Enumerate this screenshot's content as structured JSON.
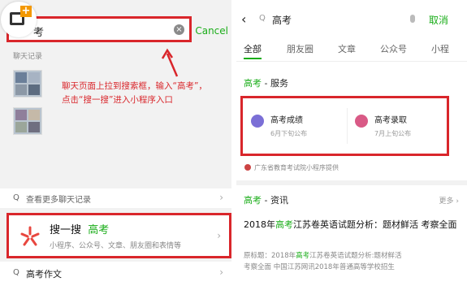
{
  "left": {
    "search_query": "考",
    "clear_glyph": "×",
    "cancel_label": "Cancel",
    "logo_plus": "+",
    "section_title": "聊天记录",
    "annotation_lines": [
      "聊天页面上拉到搜索框，输入“高考”，",
      "点击“搜一搜”进入小程序入口"
    ],
    "more_chat": "查看更多聊天记录",
    "search_item": {
      "title": "搜一搜",
      "keyword": "高考",
      "subtitle": "小程序、公众号、文章、朋友圈和表情等"
    },
    "bottom_item": "高考作文",
    "chevron": "›",
    "search_glyph": "Q",
    "accent_color": "#d9262b"
  },
  "right": {
    "back_glyph": "‹",
    "search_glyph": "Q",
    "query": "高考",
    "cancel_label": "取消",
    "tabs": [
      "全部",
      "朋友圈",
      "文章",
      "公众号",
      "小程"
    ],
    "service_section": {
      "keyword": "高考",
      "suffix": " - 服务"
    },
    "services": [
      {
        "name": "高考成绩",
        "desc": "6月下旬公布",
        "color": "#7b6fd6"
      },
      {
        "name": "高考录取",
        "desc": "7月上旬公布",
        "color": "#d95a86"
      }
    ],
    "provider": "广东省教育考试院小程序提供",
    "info_section": {
      "keyword": "高考",
      "suffix": " - 资讯"
    },
    "more_label": "更多 ›",
    "article": {
      "title_pre": "2018年",
      "title_kw": "高考",
      "title_post": "江苏卷英语试题分析：题材鲜活 考察全面",
      "body_line1_pre": "原标题：2018年",
      "body_line1_kw": "高考",
      "body_line1_post": "江苏卷英语试题分析:题材鲜活",
      "body_line2": "考察全面 中国江苏网讯2018年普通高等学校招生"
    },
    "accent_color": "#1aad19"
  }
}
